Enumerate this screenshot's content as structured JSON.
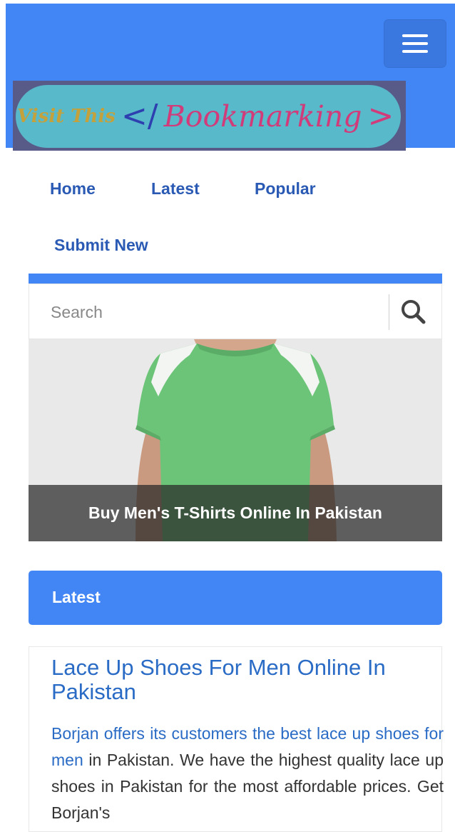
{
  "header": {
    "menu_icon": "hamburger-icon",
    "logo": {
      "part1": "Visit This",
      "open": "</",
      "word": "Bookmarking",
      "close": ">"
    }
  },
  "nav": {
    "items": [
      {
        "label": "Home"
      },
      {
        "label": "Latest"
      },
      {
        "label": "Popular"
      },
      {
        "label": "Submit New"
      }
    ]
  },
  "search": {
    "placeholder": "Search",
    "icon": "search-icon"
  },
  "featured": {
    "caption": "Buy Men's T-Shirts Online In Pakistan"
  },
  "latest": {
    "heading": "Latest"
  },
  "post": {
    "title": "Lace Up Shoes For Men Online In Pakistan",
    "link_text": "Borjan offers its customers the best lace up shoes for men",
    "body": " in Pakistan. We have the highest quality lace up shoes in Pakistan for the most affordable prices. Get Borjan's"
  },
  "colors": {
    "primary": "#4285f4",
    "link": "#2a6bc5",
    "nav_link": "#2a5ab4",
    "caption_bg": "#282828"
  }
}
